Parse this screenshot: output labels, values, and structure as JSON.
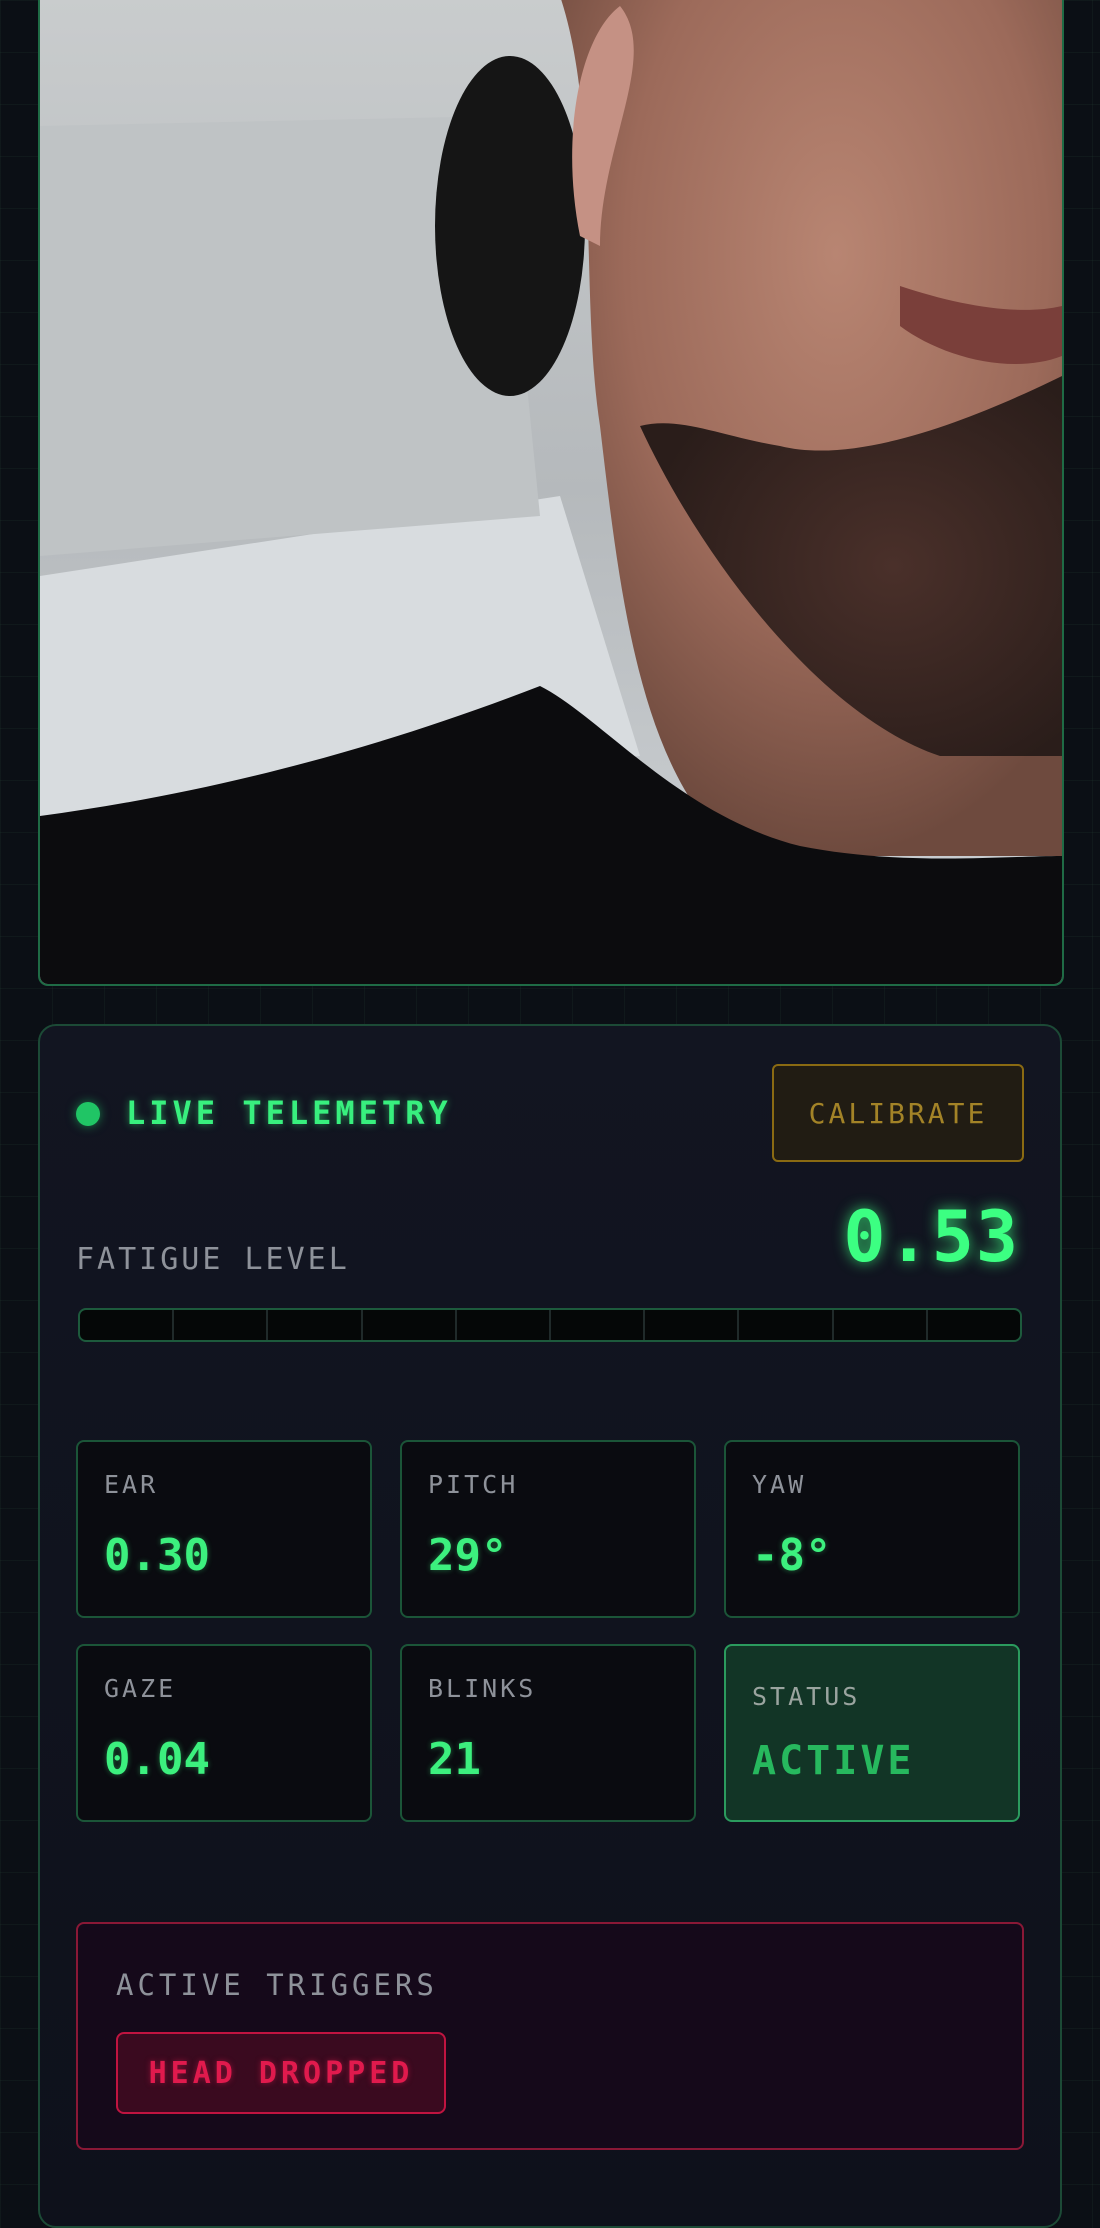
{
  "camera": {
    "alt": "webcam feed"
  },
  "telemetry": {
    "title": "LIVE TELEMETRY",
    "calibrate_label": "CALIBRATE",
    "fatigue_label": "FATIGUE LEVEL",
    "fatigue_value": "0.53",
    "fatigue_fill": 0.0,
    "fatigue_segments": 10
  },
  "metrics": [
    {
      "label": "EAR",
      "value": "0.30"
    },
    {
      "label": "PITCH",
      "value": "29°"
    },
    {
      "label": "YAW",
      "value": "-8°"
    },
    {
      "label": "GAZE",
      "value": "0.04"
    },
    {
      "label": "BLINKS",
      "value": "21"
    },
    {
      "label": "STATUS",
      "value": "ACTIVE"
    }
  ],
  "triggers": {
    "label": "ACTIVE TRIGGERS",
    "items": [
      "HEAD DROPPED"
    ]
  },
  "colors": {
    "accent": "#3cf07e",
    "warning": "#a38327",
    "alert": "#e01a4d",
    "background": "#0b0f15"
  }
}
